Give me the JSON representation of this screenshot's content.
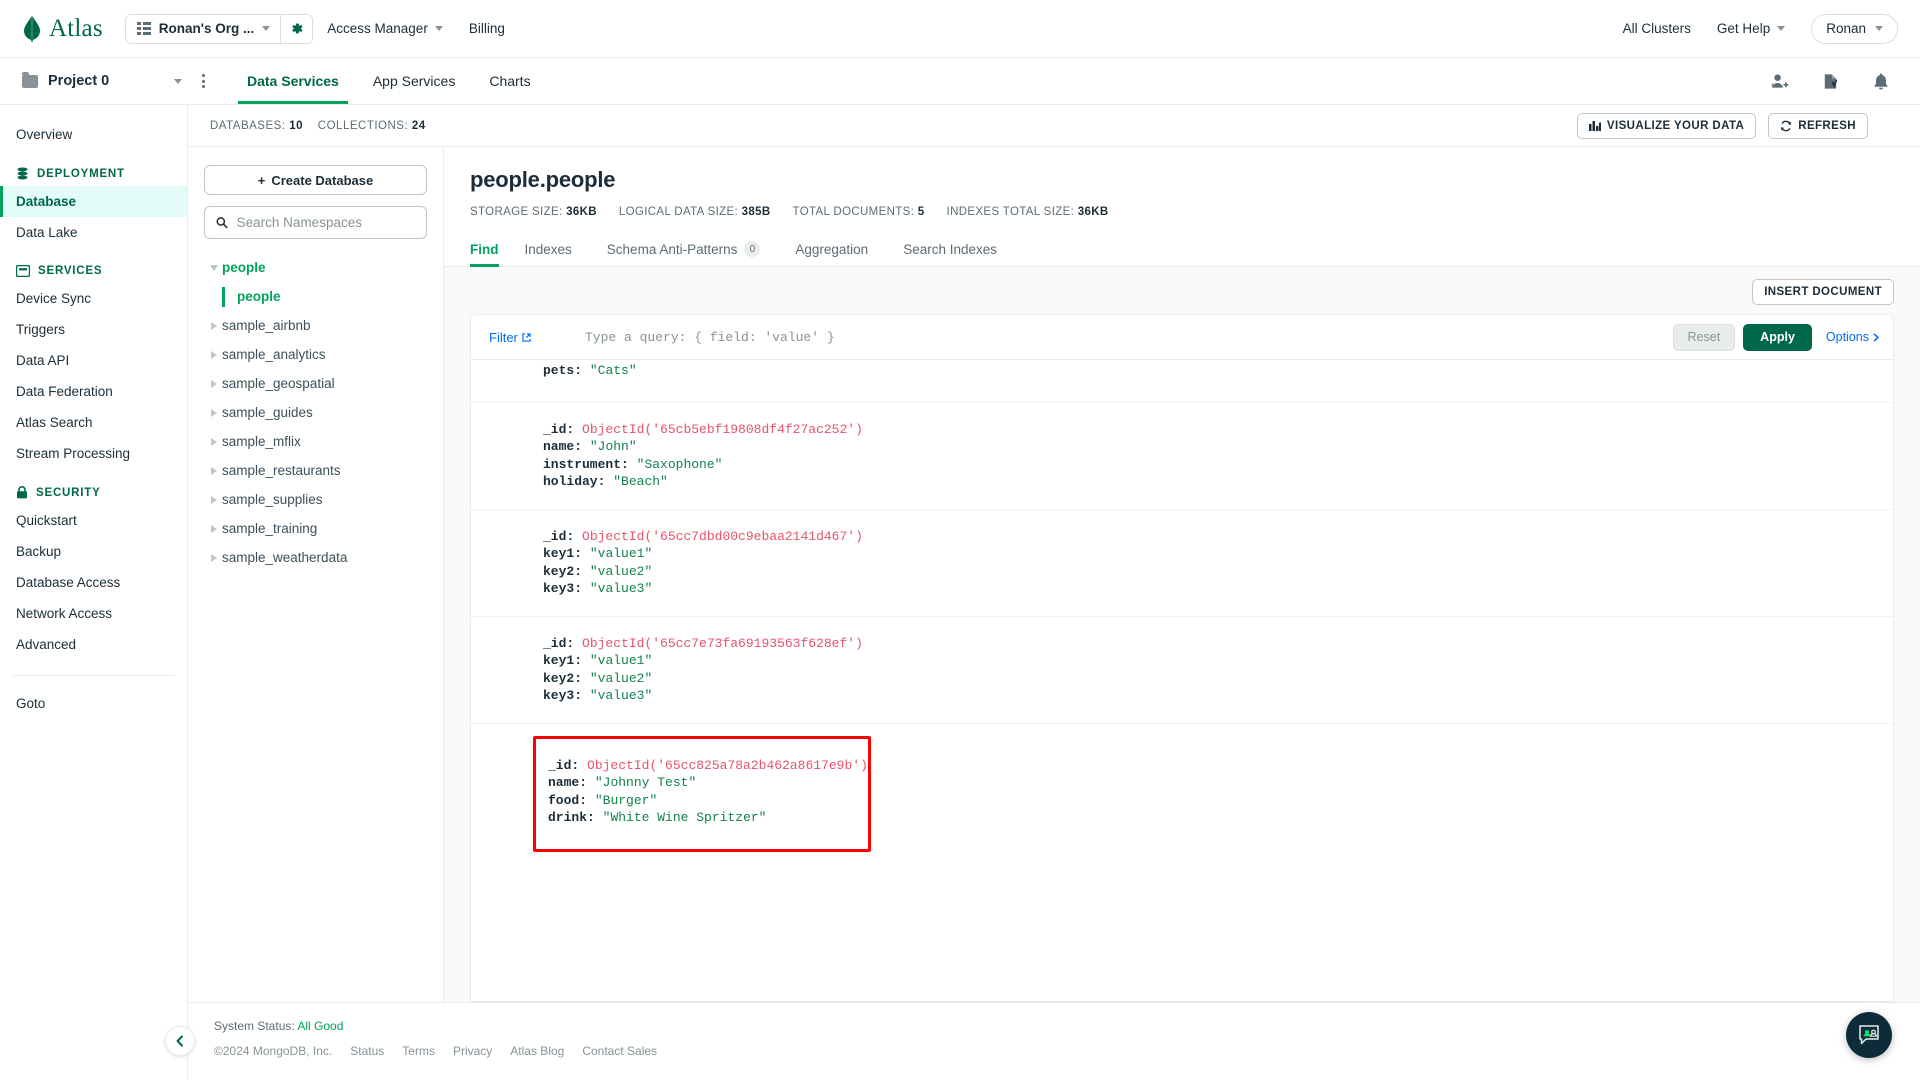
{
  "orgbar": {
    "brand": "Atlas",
    "org_name": "Ronan's Org ...",
    "access_manager": "Access Manager",
    "billing": "Billing",
    "all_clusters": "All Clusters",
    "get_help": "Get Help",
    "user": "Ronan"
  },
  "projbar": {
    "project_name": "Project 0",
    "tabs": [
      {
        "label": "Data Services",
        "active": true
      },
      {
        "label": "App Services",
        "active": false
      },
      {
        "label": "Charts",
        "active": false
      }
    ],
    "icons": [
      "invite-user-icon",
      "activity-feed-icon",
      "bell-icon"
    ]
  },
  "sidebar": {
    "top": [
      {
        "label": "Overview",
        "selected": false
      }
    ],
    "groups": [
      {
        "title": "DEPLOYMENT",
        "icon": "database-icon",
        "items": [
          {
            "label": "Database",
            "selected": true
          },
          {
            "label": "Data Lake",
            "selected": false
          }
        ]
      },
      {
        "title": "SERVICES",
        "icon": "services-icon",
        "items": [
          {
            "label": "Device Sync",
            "selected": false
          },
          {
            "label": "Triggers",
            "selected": false
          },
          {
            "label": "Data API",
            "selected": false
          },
          {
            "label": "Data Federation",
            "selected": false
          },
          {
            "label": "Atlas Search",
            "selected": false
          },
          {
            "label": "Stream Processing",
            "selected": false
          }
        ]
      },
      {
        "title": "SECURITY",
        "icon": "lock-icon",
        "items": [
          {
            "label": "Quickstart",
            "selected": false
          },
          {
            "label": "Backup",
            "selected": false
          },
          {
            "label": "Database Access",
            "selected": false
          },
          {
            "label": "Network Access",
            "selected": false
          },
          {
            "label": "Advanced",
            "selected": false
          }
        ]
      }
    ],
    "bottom": [
      {
        "label": "Goto",
        "selected": false
      }
    ],
    "collapse_icon": "chevron-left-icon"
  },
  "stats_bar": {
    "databases_label": "DATABASES:",
    "databases_count": "10",
    "collections_label": "COLLECTIONS:",
    "collections_count": "24",
    "visualize_button": "VISUALIZE YOUR DATA",
    "refresh_button": "REFRESH"
  },
  "db_pane": {
    "create_database": "Create Database",
    "search_placeholder": "Search Namespaces",
    "search_value": "",
    "tree": [
      {
        "label": "people",
        "type": "database",
        "expanded": true
      },
      {
        "label": "people",
        "type": "collection",
        "selected": true
      },
      {
        "label": "sample_airbnb",
        "type": "database",
        "expanded": false
      },
      {
        "label": "sample_analytics",
        "type": "database",
        "expanded": false
      },
      {
        "label": "sample_geospatial",
        "type": "database",
        "expanded": false
      },
      {
        "label": "sample_guides",
        "type": "database",
        "expanded": false
      },
      {
        "label": "sample_mflix",
        "type": "database",
        "expanded": false
      },
      {
        "label": "sample_restaurants",
        "type": "database",
        "expanded": false
      },
      {
        "label": "sample_supplies",
        "type": "database",
        "expanded": false
      },
      {
        "label": "sample_training",
        "type": "database",
        "expanded": false
      },
      {
        "label": "sample_weatherdata",
        "type": "database",
        "expanded": false
      }
    ]
  },
  "collection": {
    "title": "people.people",
    "metrics": [
      {
        "label": "STORAGE SIZE:",
        "value": "36KB"
      },
      {
        "label": "LOGICAL DATA SIZE:",
        "value": "385B"
      },
      {
        "label": "TOTAL DOCUMENTS:",
        "value": "5"
      },
      {
        "label": "INDEXES TOTAL SIZE:",
        "value": "36KB"
      }
    ],
    "tabs": [
      {
        "label": "Find",
        "active": true,
        "badge": null
      },
      {
        "label": "Indexes",
        "active": false,
        "badge": null
      },
      {
        "label": "Schema Anti-Patterns",
        "active": false,
        "badge": "0"
      },
      {
        "label": "Aggregation",
        "active": false,
        "badge": null
      },
      {
        "label": "Search Indexes",
        "active": false,
        "badge": null
      }
    ],
    "insert_button": "INSERT DOCUMENT"
  },
  "query": {
    "filter_label": "Filter",
    "filter_icon": "external-link-icon",
    "placeholder": "Type a query: { field: 'value' }",
    "value": "",
    "reset_button": "Reset",
    "apply_button": "Apply",
    "options_label": "Options"
  },
  "documents": [
    {
      "partial": true,
      "highlighted": false,
      "fields": [
        {
          "key": "pets",
          "value": "\"Cats\"",
          "kind": "string"
        }
      ]
    },
    {
      "partial": false,
      "highlighted": false,
      "fields": [
        {
          "key": "_id",
          "value": "ObjectId('65cb5ebf19808df4f27ac252')",
          "kind": "objectid"
        },
        {
          "key": "name",
          "value": "\"John\"",
          "kind": "string"
        },
        {
          "key": "instrument",
          "value": "\"Saxophone\"",
          "kind": "string"
        },
        {
          "key": "holiday",
          "value": "\"Beach\"",
          "kind": "string"
        }
      ]
    },
    {
      "partial": false,
      "highlighted": false,
      "fields": [
        {
          "key": "_id",
          "value": "ObjectId('65cc7dbd00c9ebaa2141d467')",
          "kind": "objectid"
        },
        {
          "key": "key1",
          "value": "\"value1\"",
          "kind": "string"
        },
        {
          "key": "key2",
          "value": "\"value2\"",
          "kind": "string"
        },
        {
          "key": "key3",
          "value": "\"value3\"",
          "kind": "string"
        }
      ]
    },
    {
      "partial": false,
      "highlighted": false,
      "fields": [
        {
          "key": "_id",
          "value": "ObjectId('65cc7e73fa69193563f628ef')",
          "kind": "objectid"
        },
        {
          "key": "key1",
          "value": "\"value1\"",
          "kind": "string"
        },
        {
          "key": "key2",
          "value": "\"value2\"",
          "kind": "string"
        },
        {
          "key": "key3",
          "value": "\"value3\"",
          "kind": "string"
        }
      ]
    },
    {
      "partial": false,
      "highlighted": true,
      "fields": [
        {
          "key": "_id",
          "value": "ObjectId('65cc825a78a2b462a8617e9b')",
          "kind": "objectid"
        },
        {
          "key": "name",
          "value": "\"Johnny Test\"",
          "kind": "string"
        },
        {
          "key": "food",
          "value": "\"Burger\"",
          "kind": "string"
        },
        {
          "key": "drink",
          "value": "\"White Wine Spritzer\"",
          "kind": "string"
        }
      ]
    }
  ],
  "footer": {
    "status_label": "System Status:",
    "status_value": "All Good",
    "copyright": "©2024 MongoDB, Inc.",
    "links": [
      "Status",
      "Terms",
      "Privacy",
      "Atlas Blog",
      "Contact Sales"
    ]
  },
  "colors": {
    "brand_green": "#00684a",
    "accent_green": "#00a35c",
    "highlight_red": "#ff0000",
    "link_blue": "#016bf8",
    "string_green": "#12824d",
    "objectid_red": "#e8536c"
  }
}
